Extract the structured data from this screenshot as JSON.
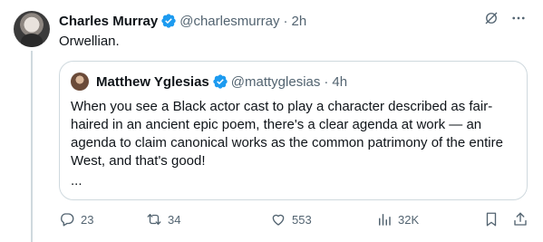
{
  "tweet": {
    "author_name": "Charles Murray",
    "author_handle": "@charlesmurray",
    "separator": "·",
    "time": "2h",
    "text": "Orwellian."
  },
  "quote": {
    "author_name": "Matthew Yglesias",
    "author_handle": "@mattyglesias",
    "separator": "·",
    "time": "4h",
    "text": "When you see a Black actor cast to play a character described as fair-haired in an ancient epic poem, there's a clear agenda at work — an agenda to claim canonical works as the common patrimony of the entire West, and that's good!",
    "more": "..."
  },
  "actions": {
    "replies": "23",
    "reposts": "34",
    "likes": "553",
    "views": "32K"
  },
  "icons": {
    "verified": "verified-badge-icon",
    "grok": "grok-icon",
    "more": "more-icon",
    "reply": "reply-icon",
    "repost": "repost-icon",
    "like": "heart-icon",
    "views": "views-icon",
    "bookmark": "bookmark-icon",
    "share": "share-icon"
  },
  "colors": {
    "verified": "#1d9bf0",
    "text": "#0f1419",
    "muted": "#536471",
    "border": "#cfd9de"
  }
}
